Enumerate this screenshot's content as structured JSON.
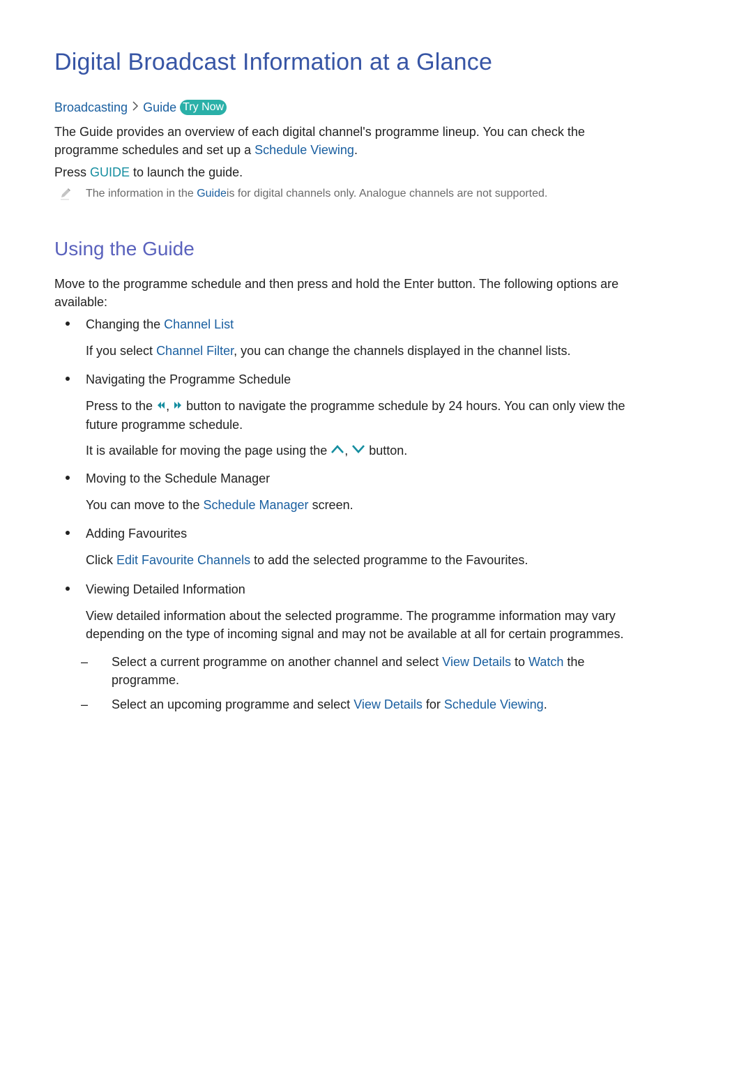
{
  "title": "Digital Broadcast Information at a Glance",
  "breadcrumb": {
    "items": [
      "Broadcasting",
      "Guide"
    ],
    "separator_icon": "chevron-right-icon",
    "try_now": "Try Now"
  },
  "intro": {
    "line1": "The Guide provides an overview of each digital channel's programme lineup. You can check the",
    "line2_pre": "programme schedules and set up a ",
    "line2_link": "Schedule Viewing",
    "line2_post": ".",
    "press_pre": "Press ",
    "press_key": "GUIDE",
    "press_post": " to launch the guide."
  },
  "note": {
    "icon": "pencil-icon",
    "pre": "The information in the ",
    "link": "Guide",
    "post": " is for digital channels only. Analogue channels are not supported."
  },
  "section": {
    "heading": "Using the Guide",
    "intro_line1": "Move to the programme schedule and then press and hold the Enter button. The following options are",
    "intro_line2": "available:",
    "items": [
      {
        "label_pre": "Changing the ",
        "label_link": "Channel List",
        "desc_pre": "If you select ",
        "desc_link": "Channel Filter",
        "desc_post": ", you can change the channels displayed in the channel lists."
      },
      {
        "label": "Navigating the Programme Schedule",
        "desc1_pre": "Press to the ",
        "rewind_icon": "rewind-icon",
        "comma": ", ",
        "forward_icon": "fast-forward-icon",
        "desc1_post": " button to navigate the programme schedule by 24 hours. You can only view the",
        "desc1_line2": "future programme schedule.",
        "desc2_pre": "It is available for moving the page using the ",
        "up_icon": "chevron-up-icon",
        "down_icon": "chevron-down-icon",
        "desc2_post": " button."
      },
      {
        "label": "Moving to the Schedule Manager",
        "desc_pre": "You can move to the ",
        "desc_link": "Schedule Manager",
        "desc_post": " screen."
      },
      {
        "label": "Adding Favourites",
        "desc_pre": "Click ",
        "desc_link": "Edit Favourite Channels",
        "desc_post": " to add the selected programme to the Favourites."
      },
      {
        "label": "Viewing Detailed Information",
        "desc_line1": "View detailed information about the selected programme. The programme information may vary",
        "desc_line2": "depending on the type of incoming signal and may not be available at all for certain programmes.",
        "subitems": [
          {
            "dash": "–",
            "pre": "Select a current programme on another channel and select ",
            "link1": "View Details",
            "mid": " to ",
            "link2": "Watch",
            "post": " the",
            "line2": "programme."
          },
          {
            "dash": "–",
            "pre": "Select an upcoming programme and select ",
            "link1": "View Details",
            "mid": " for ",
            "link2": "Schedule Viewing",
            "post": "."
          }
        ]
      }
    ]
  },
  "colors": {
    "title": "#3755a5",
    "subheading": "#5a62bd",
    "link": "#1a5fa0",
    "key": "#168ea0",
    "try_now_bg": "#2ab0a8"
  }
}
